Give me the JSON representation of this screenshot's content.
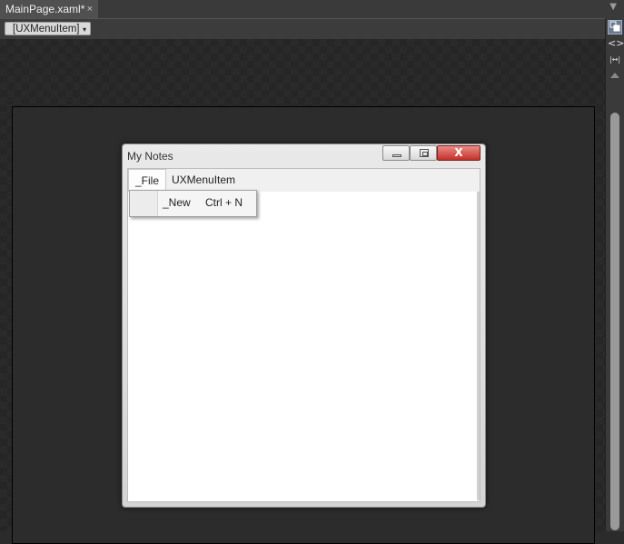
{
  "tabs": [
    {
      "label": "MainPage.xaml*",
      "close_glyph": "×"
    }
  ],
  "tab_dropdown_glyph": "▼",
  "element_selector": {
    "label": "[UXMenuItem]",
    "caret": "▾"
  },
  "right_toolbar": {
    "buttons": [
      "layers-icon",
      "code-view-icon",
      "width-icon"
    ],
    "code_glyph": "<>",
    "width_glyph": "|↔|"
  },
  "window": {
    "title": "My Notes",
    "close_glyph": "X"
  },
  "menu": {
    "items": [
      {
        "label": "_File"
      },
      {
        "label": "UXMenuItem"
      }
    ],
    "dropdown": {
      "label": "_New",
      "shortcut": "Ctrl + N"
    }
  },
  "colors": {
    "close_button": "#c3312a",
    "canvas_bg": "#2a2a2a",
    "selector_bg": "#d8d8d8"
  }
}
